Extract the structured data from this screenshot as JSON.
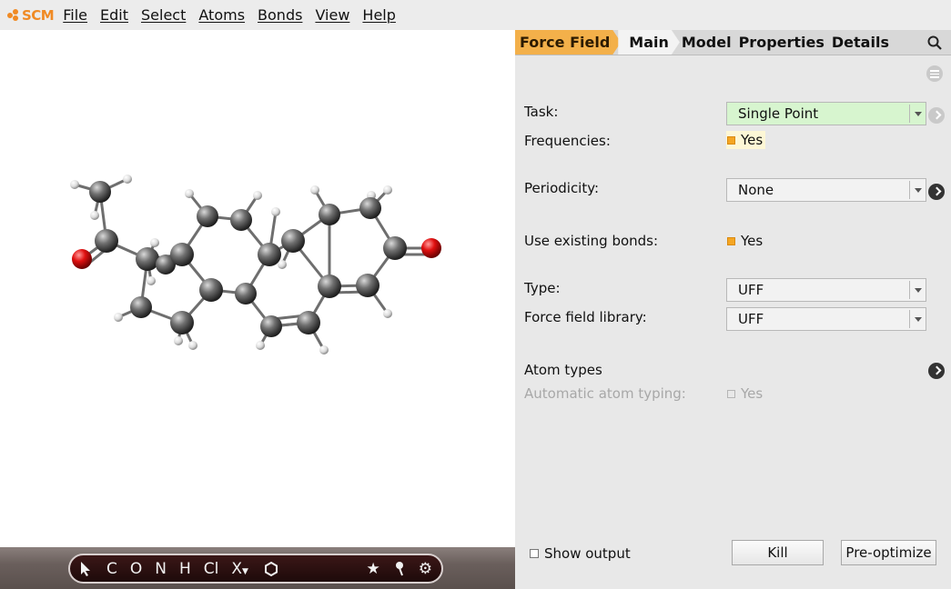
{
  "app": {
    "logo_text": "SCM",
    "brand_color": "#f08a24"
  },
  "menubar": {
    "items": [
      "File",
      "Edit",
      "Select",
      "Atoms",
      "Bonds",
      "View",
      "Help"
    ]
  },
  "tabs": {
    "items": [
      "Force Field",
      "Main",
      "Model",
      "Properties",
      "Details"
    ],
    "active": "Main"
  },
  "form": {
    "task_label": "Task:",
    "task_value": "Single Point",
    "frequencies_label": "Frequencies:",
    "frequencies_value": "Yes",
    "periodicity_label": "Periodicity:",
    "periodicity_value": "None",
    "bonds_label": "Use existing bonds:",
    "bonds_value": "Yes",
    "type_label": "Type:",
    "type_value": "UFF",
    "library_label": "Force field library:",
    "library_value": "UFF",
    "atom_types_label": "Atom types",
    "auto_typing_label": "Automatic atom typing:",
    "auto_typing_value": "Yes"
  },
  "footer": {
    "show_output_label": "Show output",
    "kill_label": "Kill",
    "preoptimize_label": "Pre-optimize"
  },
  "toolbar": {
    "elements": [
      "C",
      "O",
      "N",
      "H",
      "Cl",
      "X"
    ]
  },
  "colors": {
    "force_field_tab": "#f3b04a",
    "task_field_bg": "#d7f5cf",
    "checkbox_on": "#f5a623"
  }
}
